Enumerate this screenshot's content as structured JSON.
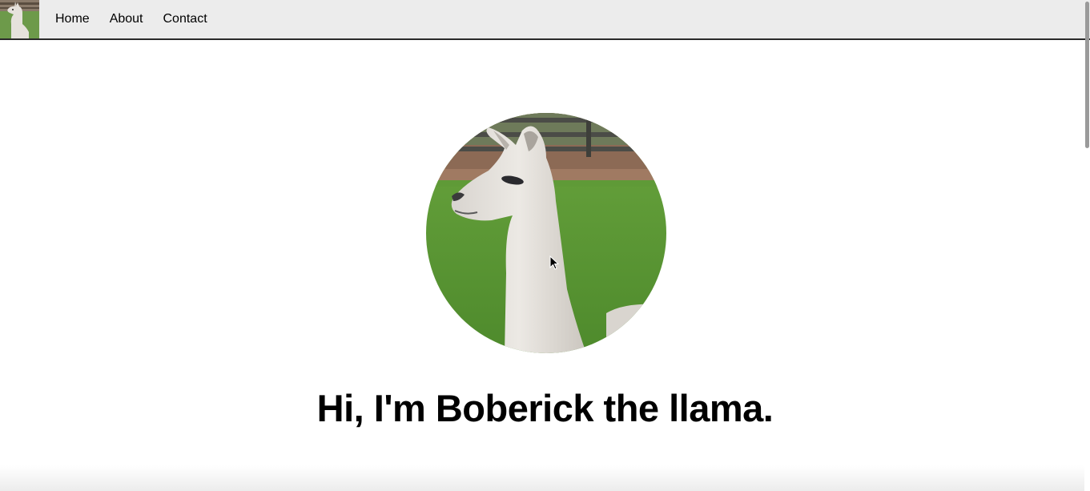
{
  "nav": {
    "logo_icon": "llama-thumbnail",
    "links": [
      {
        "label": "Home"
      },
      {
        "label": "About"
      },
      {
        "label": "Contact"
      }
    ]
  },
  "hero": {
    "image_icon": "llama-portrait",
    "title": "Hi, I'm Boberick the llama."
  },
  "colors": {
    "nav_background": "#ececec",
    "nav_border": "#2a2a2a",
    "page_background": "#ffffff",
    "text": "#000000"
  }
}
